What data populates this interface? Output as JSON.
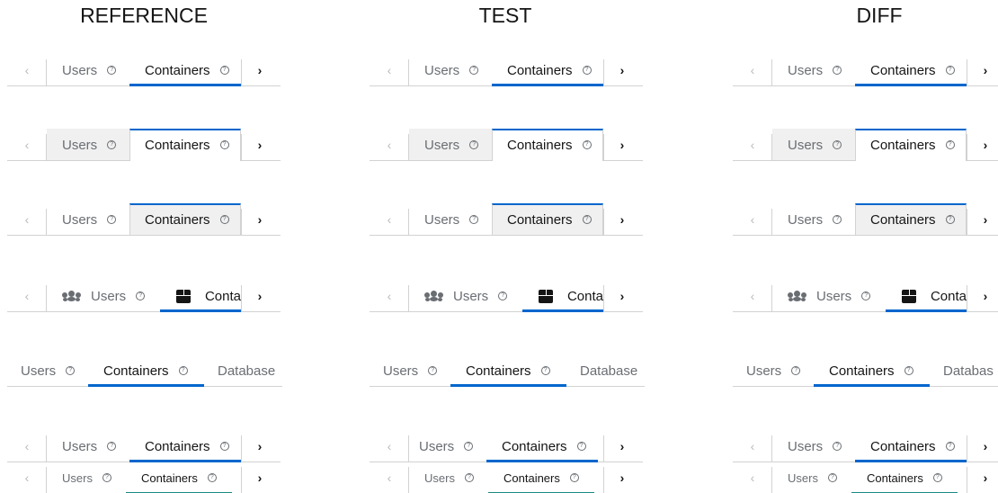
{
  "headers": {
    "reference": "REFERENCE",
    "test": "TEST",
    "diff": "DIFF"
  },
  "tabs": {
    "users": "Users",
    "containers": "Containers",
    "containers_truncated": "Conta",
    "database": "Database",
    "database_truncated": "Databas"
  },
  "icons": {
    "scroll_left": "chevron-left-icon",
    "scroll_right": "chevron-right-icon",
    "help": "help-circle-icon",
    "users": "users-icon",
    "containers": "cube-icon"
  },
  "colors": {
    "accent": "#0066cc",
    "inset_accent": "#1a8a84",
    "diff_highlight": "#e000e0",
    "text": "#151515",
    "muted": "#6a6e73",
    "border": "#d2d2d2",
    "grey_fill": "#f0f0f0"
  }
}
